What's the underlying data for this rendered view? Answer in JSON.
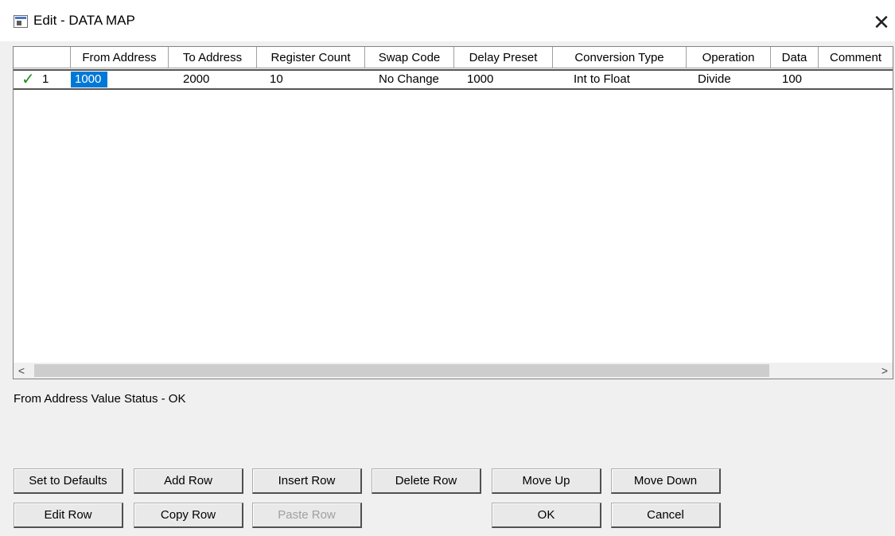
{
  "window": {
    "title": "Edit - DATA MAP",
    "close_glyph": "✕"
  },
  "table": {
    "headers": [
      "",
      "From Address",
      "To Address",
      "Register Count",
      "Swap Code",
      "Delay Preset",
      "Conversion Type",
      "Operation",
      "Data",
      "Comment"
    ],
    "rows": [
      {
        "status_icon": "checkmark-icon",
        "row_number": "1",
        "from_address": "1000",
        "to_address": "2000",
        "register_count": "10",
        "swap_code": "No Change",
        "delay_preset": "1000",
        "conversion_type": "Int to Float",
        "operation": "Divide",
        "data": "100",
        "comment": ""
      }
    ]
  },
  "scrollbar": {
    "left_glyph": "<",
    "right_glyph": ">"
  },
  "status_text": "From Address Value Status - OK",
  "buttons": {
    "set_defaults": "Set to Defaults",
    "add_row": "Add Row",
    "insert_row": "Insert Row",
    "delete_row": "Delete Row",
    "move_up": "Move Up",
    "move_down": "Move Down",
    "edit_row": "Edit Row",
    "copy_row": "Copy Row",
    "paste_row": "Paste Row",
    "ok": "OK",
    "cancel": "Cancel"
  },
  "colors": {
    "selection": "#0078d7",
    "check": "#1e8f1e",
    "dialog_bg": "#f0f0f0"
  }
}
